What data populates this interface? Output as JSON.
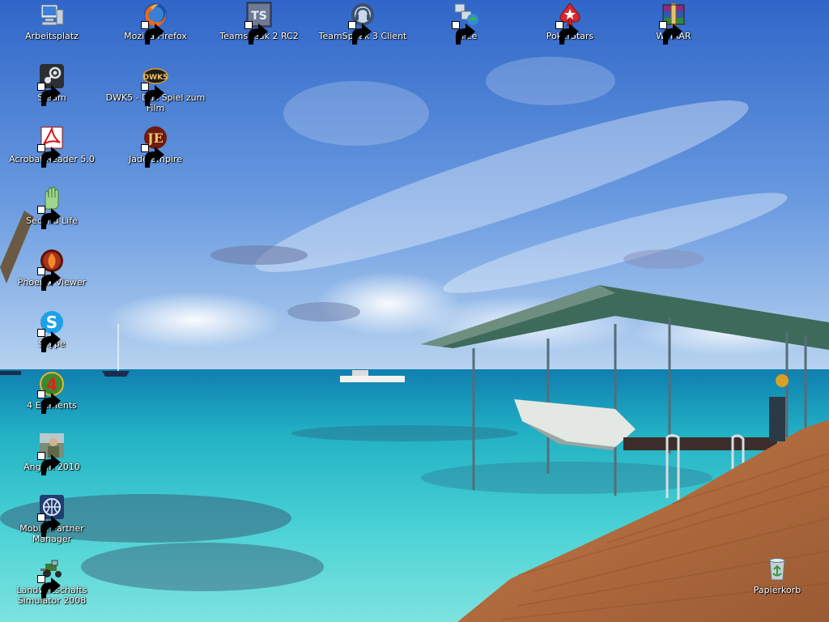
{
  "desktop": {
    "icons": [
      {
        "id": "arbeitsplatz",
        "label": "Arbeitsplatz",
        "icon": "my-computer-icon",
        "shortcut": false
      },
      {
        "id": "firefox",
        "label": "Mozilla Firefox",
        "icon": "firefox-icon",
        "shortcut": true
      },
      {
        "id": "teamspeak2",
        "label": "Teamspeak 2 RC2",
        "icon": "teamspeak2-icon",
        "shortcut": true
      },
      {
        "id": "teamspeak3",
        "label": "TeamSpeak 3 Client",
        "icon": "teamspeak3-icon",
        "shortcut": true
      },
      {
        "id": "alice",
        "label": "Alice",
        "icon": "alice-network-icon",
        "shortcut": true
      },
      {
        "id": "pokerstars",
        "label": "PokerStars",
        "icon": "pokerstars-icon",
        "shortcut": true
      },
      {
        "id": "winrar",
        "label": "WinRAR",
        "icon": "winrar-icon",
        "shortcut": true
      },
      {
        "id": "steam",
        "label": "Steam",
        "icon": "steam-icon",
        "shortcut": true
      },
      {
        "id": "dwk5",
        "label": "DWK5 - Das Spiel zum Film",
        "icon": "dwk5-icon",
        "shortcut": true
      },
      {
        "id": "acrobat",
        "label": "Acrobat Reader 5.0",
        "icon": "acrobat-icon",
        "shortcut": true
      },
      {
        "id": "jadeempire",
        "label": "Jade Empire",
        "icon": "jade-empire-icon",
        "shortcut": true
      },
      {
        "id": "secondlife",
        "label": "Second Life",
        "icon": "second-life-icon",
        "shortcut": true
      },
      {
        "id": "phoenix",
        "label": "Phoenix Viewer",
        "icon": "phoenix-viewer-icon",
        "shortcut": true
      },
      {
        "id": "skype",
        "label": "Skype",
        "icon": "skype-icon",
        "shortcut": true
      },
      {
        "id": "4elements",
        "label": "4 Elements",
        "icon": "four-elements-icon",
        "shortcut": true
      },
      {
        "id": "angeln",
        "label": "Angeln 2010",
        "icon": "angeln-icon",
        "shortcut": true
      },
      {
        "id": "mobilepartner",
        "label": "Mobile Partner Manager",
        "icon": "mobile-partner-icon",
        "shortcut": true
      },
      {
        "id": "landwirtschaft",
        "label": "Landwirtschafts Simulator 2008",
        "icon": "tractor-icon",
        "shortcut": true
      },
      {
        "id": "papierkorb",
        "label": "Papierkorb",
        "icon": "recycle-bin-icon",
        "shortcut": false
      }
    ]
  },
  "colors": {
    "sky_top": "#2f66c8",
    "sky_horizon": "#a9c9ee",
    "sea_deep": "#1c8fb0",
    "sea_shallow": "#4fd2d8",
    "dock_wood": "#b5673a"
  }
}
